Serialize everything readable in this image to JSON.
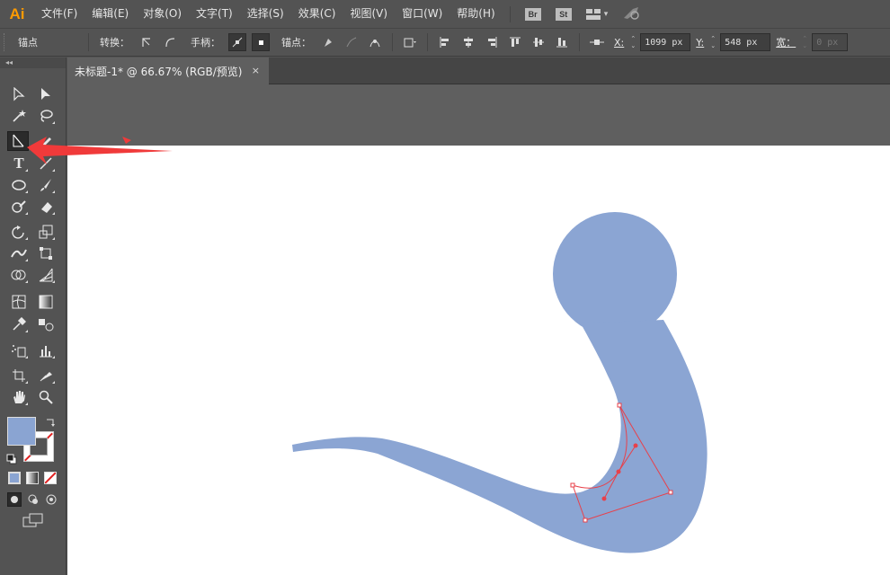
{
  "app": {
    "logo": "Ai"
  },
  "menu": [
    "文件(F)",
    "编辑(E)",
    "对象(O)",
    "文字(T)",
    "选择(S)",
    "效果(C)",
    "视图(V)",
    "窗口(W)",
    "帮助(H)"
  ],
  "menubar_buttons": {
    "bridge": "Br",
    "stock": "St"
  },
  "control_bar": {
    "context_label": "锚点",
    "convert_label": "转换：",
    "handles_label": "手柄：",
    "anchors_label": "锚点：",
    "x_label": "X:",
    "x_value": "1099 px",
    "y_label": "Y:",
    "y_value": "548 px",
    "width_label": "宽：",
    "width_value": "0 px"
  },
  "document_tab": {
    "title": "未标题-1* @ 66.67% (RGB/预览)",
    "close": "×"
  },
  "colors": {
    "fill": "#8aa4d2",
    "shape": "#8ba5d3",
    "path_selection": "#e8404a",
    "annotation_arrow": "#f03a3a",
    "app_bg": "#535353"
  },
  "tools": {
    "selected": "line-segment-tool"
  }
}
